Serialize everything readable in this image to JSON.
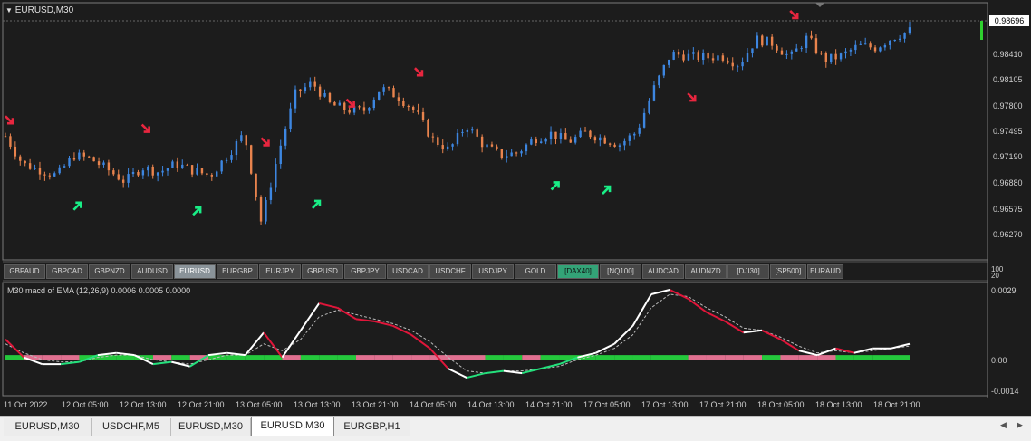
{
  "colors": {
    "background": "#1c1c1c",
    "bull_candle": "#3d86e0",
    "bear_candle": "#e8834d",
    "sell_arrow": "#e8263f",
    "buy_arrow": "#19ee86",
    "macd_line": "#ffffff",
    "macd_down": "#e0163a",
    "macd_up": "#24e07c",
    "zero_bar_green": "#24c83c",
    "zero_bar_pink": "#e07090"
  },
  "chart": {
    "title": "EURUSD,M30",
    "current_price": "0.98696",
    "price_ticks": [
      "0.98410",
      "0.98105",
      "0.97800",
      "0.97495",
      "0.97190",
      "0.96880",
      "0.96575",
      "0.96270"
    ],
    "ylim": [
      0.9627,
      0.9885
    ],
    "symbols": [
      {
        "label": "GBPAUD",
        "state": "normal"
      },
      {
        "label": "GBPCAD",
        "state": "normal"
      },
      {
        "label": "GBPNZD",
        "state": "normal"
      },
      {
        "label": "AUDUSD",
        "state": "normal"
      },
      {
        "label": "EURUSD",
        "state": "active"
      },
      {
        "label": "EURGBP",
        "state": "normal"
      },
      {
        "label": "EURJPY",
        "state": "normal"
      },
      {
        "label": "GBPUSD",
        "state": "normal"
      },
      {
        "label": "GBPJPY",
        "state": "normal"
      },
      {
        "label": "USDCAD",
        "state": "normal"
      },
      {
        "label": "USDCHF",
        "state": "normal"
      },
      {
        "label": "USDJPY",
        "state": "normal"
      },
      {
        "label": "GOLD",
        "state": "normal"
      },
      {
        "label": "[DAX40]",
        "state": "highlight"
      },
      {
        "label": "[NQ100]",
        "state": "normal"
      },
      {
        "label": "AUDCAD",
        "state": "normal"
      },
      {
        "label": "AUDNZD",
        "state": "normal"
      },
      {
        "label": "[DJI30]",
        "state": "normal"
      },
      {
        "label": "[SP500]",
        "state": "normal"
      },
      {
        "label": "EURAUD",
        "state": "normal"
      }
    ],
    "subwindow_ticks": [
      "100",
      "20"
    ]
  },
  "indicator": {
    "title": "M30  macd of EMA  (12,26,9) 0.0006 0.0005 0.0000",
    "ticks": [
      "0.0029",
      "0.00",
      "-0.0014"
    ],
    "ylim": [
      -0.0015,
      0.003
    ]
  },
  "time_axis": [
    "11 Oct 2022",
    "12 Oct 05:00",
    "12 Oct 13:00",
    "12 Oct 21:00",
    "13 Oct 05:00",
    "13 Oct 13:00",
    "13 Oct 21:00",
    "14 Oct 05:00",
    "14 Oct 13:00",
    "14 Oct 21:00",
    "17 Oct 05:00",
    "17 Oct 13:00",
    "17 Oct 21:00",
    "18 Oct 05:00",
    "18 Oct 13:00",
    "18 Oct 21:00"
  ],
  "tabs": [
    {
      "label": "EURUSD,M30",
      "active": false
    },
    {
      "label": "USDCHF,M5",
      "active": false
    },
    {
      "label": "EURUSD,M30",
      "active": false
    },
    {
      "label": "EURUSD,M30",
      "active": true
    },
    {
      "label": "EURGBP,H1",
      "active": false
    }
  ],
  "chart_data": {
    "type": "line",
    "title": "EURUSD,M30",
    "x": [
      "11 Oct 2022",
      "12 Oct 05:00",
      "12 Oct 13:00",
      "12 Oct 21:00",
      "13 Oct 05:00",
      "13 Oct 13:00",
      "13 Oct 21:00",
      "14 Oct 05:00",
      "14 Oct 13:00",
      "14 Oct 21:00",
      "17 Oct 05:00",
      "17 Oct 13:00",
      "17 Oct 21:00",
      "18 Oct 05:00",
      "18 Oct 13:00",
      "18 Oct 21:00"
    ],
    "price_path": [
      0.9745,
      0.9712,
      0.9705,
      0.9698,
      0.9722,
      0.9718,
      0.9705,
      0.9691,
      0.9708,
      0.9702,
      0.9712,
      0.9704,
      0.9698,
      0.9722,
      0.9748,
      0.9642,
      0.9725,
      0.9795,
      0.9808,
      0.9783,
      0.9776,
      0.9775,
      0.9802,
      0.9792,
      0.9775,
      0.9742,
      0.9728,
      0.9758,
      0.9735,
      0.9722,
      0.9725,
      0.9742,
      0.9748,
      0.9738,
      0.9749,
      0.9742,
      0.9735,
      0.975,
      0.9801,
      0.9843,
      0.984,
      0.9838,
      0.984,
      0.983,
      0.986,
      0.9855,
      0.9838,
      0.9862,
      0.9835,
      0.984,
      0.9852,
      0.985,
      0.9862,
      0.987
    ],
    "sell_signals": [
      [
        0,
        0.9745
      ],
      [
        8,
        0.9735
      ],
      [
        15,
        0.9719
      ],
      [
        20,
        0.9765
      ],
      [
        24,
        0.9802
      ],
      [
        40,
        0.9772
      ],
      [
        46,
        0.987
      ]
    ],
    "buy_signals": [
      [
        4,
        0.9681
      ],
      [
        11,
        0.9675
      ],
      [
        18,
        0.9683
      ],
      [
        32,
        0.9705
      ],
      [
        35,
        0.97
      ]
    ],
    "macd": [
      0.0008,
      0.0,
      -0.0003,
      -0.0003,
      -0.0002,
      0.0001,
      0.0002,
      0.0001,
      -0.0003,
      -0.0002,
      -0.0004,
      0.0001,
      0.0002,
      0.0001,
      0.0011,
      0.0,
      0.0012,
      0.0024,
      0.0022,
      0.0017,
      0.0016,
      0.0014,
      0.001,
      0.0004,
      -0.0005,
      -0.0009,
      -0.0007,
      -0.0006,
      -0.0007,
      -0.0005,
      -0.0003,
      0.0,
      0.0002,
      0.0006,
      0.0014,
      0.0028,
      0.003,
      0.0026,
      0.002,
      0.0016,
      0.0011,
      0.0012,
      0.0008,
      0.0003,
      0.0001,
      0.0004,
      0.0002,
      0.0004,
      0.0004,
      0.0006
    ],
    "signal": [
      0.0006,
      0.0002,
      -0.0001,
      -0.0002,
      -0.0002,
      0.0,
      0.0001,
      0.0001,
      -0.0001,
      -0.0002,
      -0.0003,
      -0.0001,
      0.0001,
      0.0001,
      0.0006,
      0.0003,
      0.0008,
      0.0018,
      0.0021,
      0.0019,
      0.0017,
      0.0015,
      0.0012,
      0.0007,
      0.0,
      -0.0006,
      -0.0007,
      -0.0006,
      -0.0006,
      -0.0005,
      -0.0004,
      -0.0001,
      0.0001,
      0.0004,
      0.001,
      0.0022,
      0.0028,
      0.0027,
      0.0022,
      0.0018,
      0.0013,
      0.0012,
      0.0009,
      0.0005,
      0.0002,
      0.0003,
      0.0002,
      0.0003,
      0.0004,
      0.0005
    ]
  }
}
